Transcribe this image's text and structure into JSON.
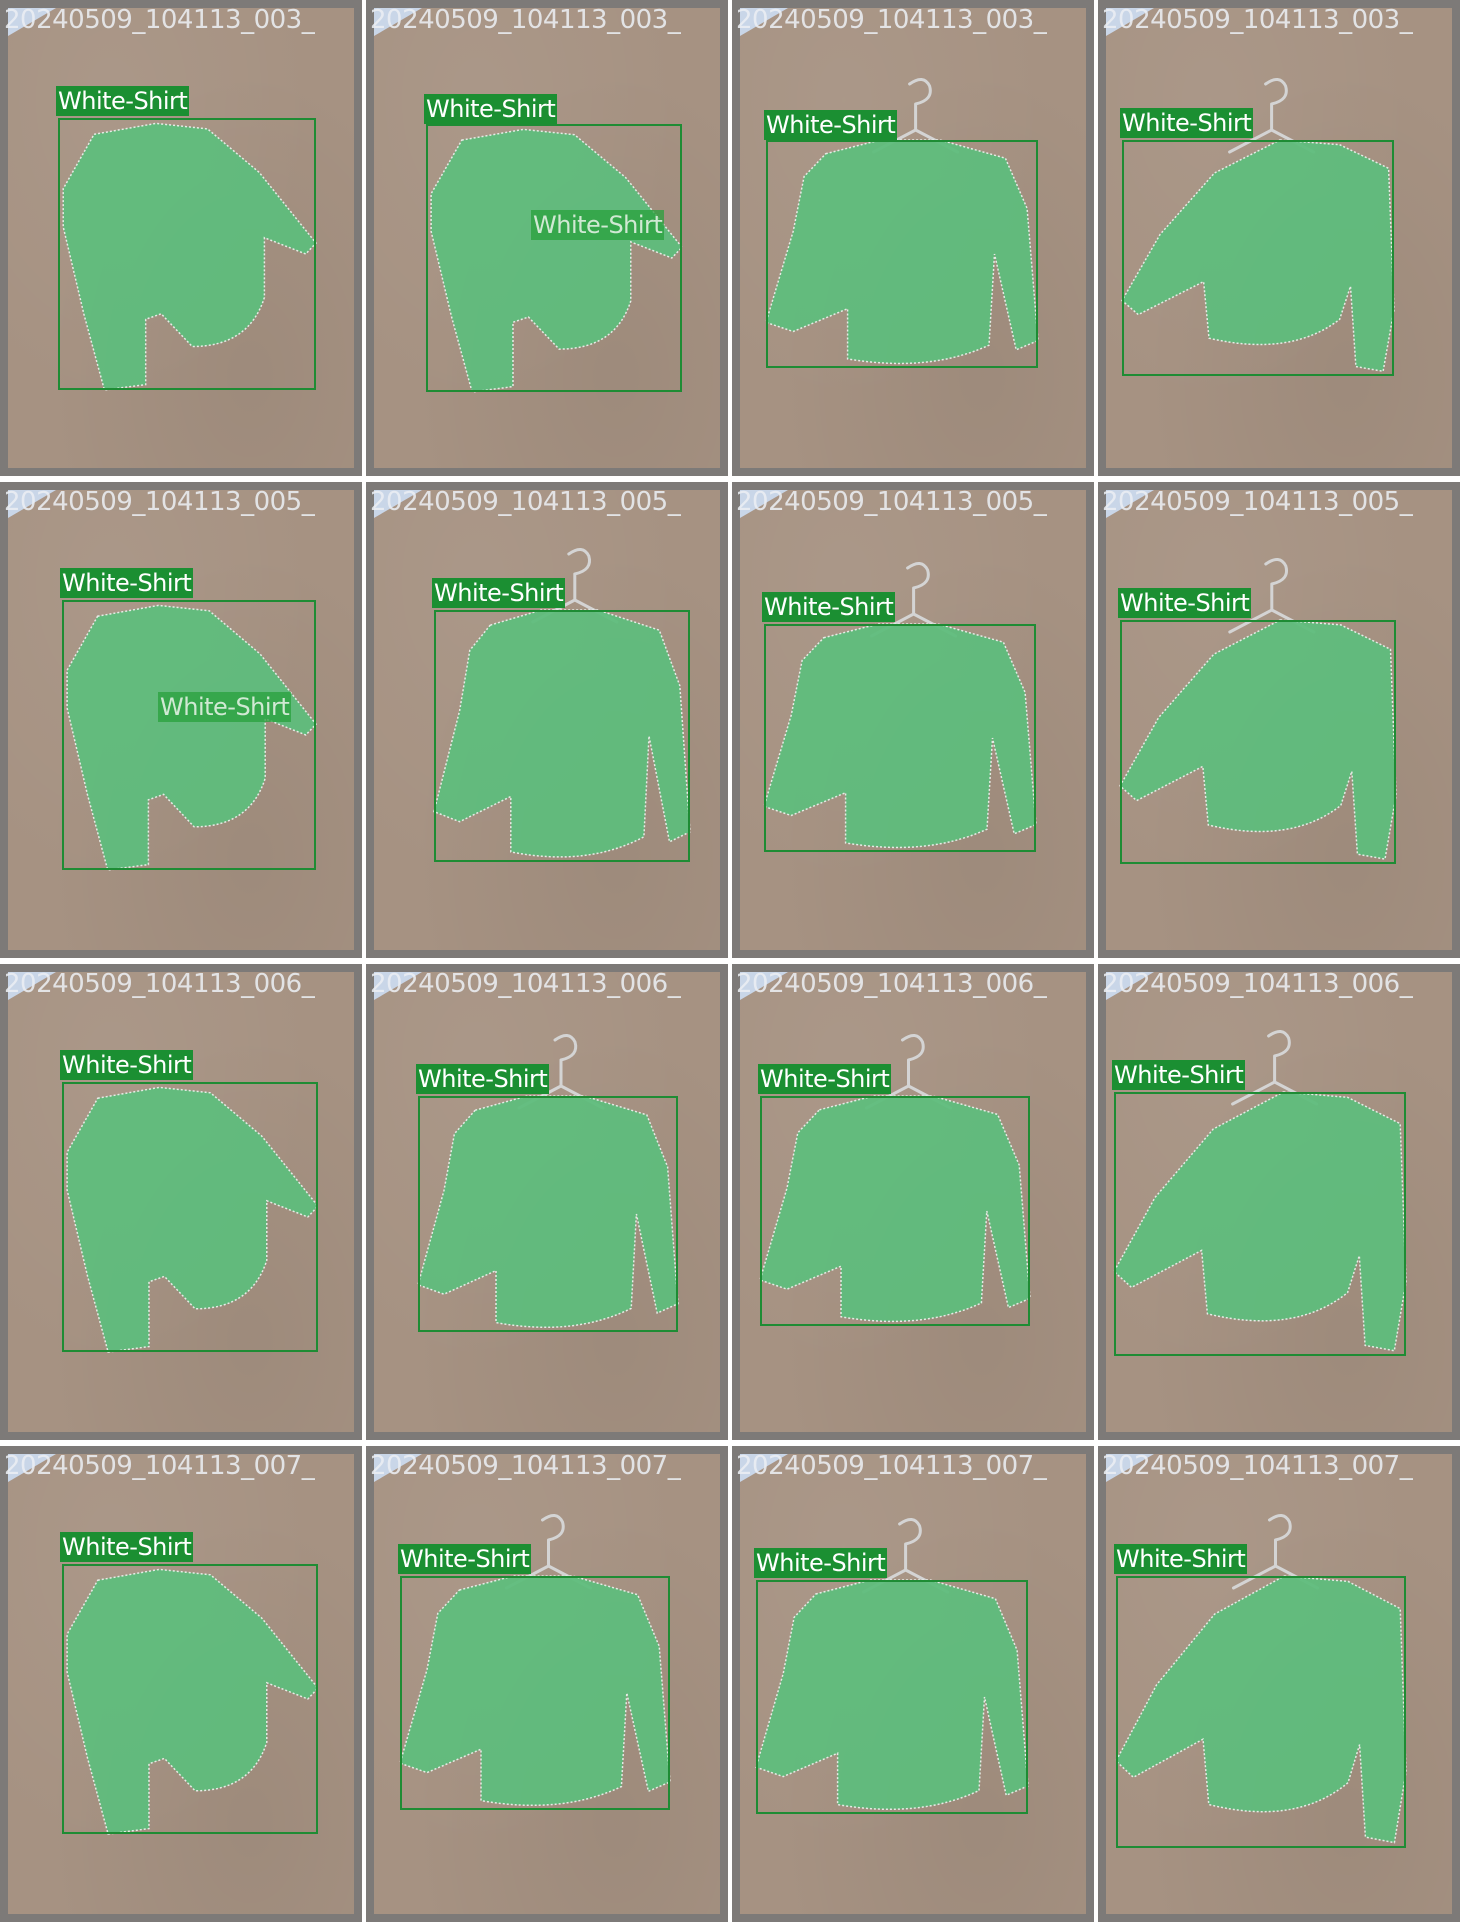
{
  "colors": {
    "mask": "#5fbd7c",
    "box": "#1e8c34",
    "label_bg": "#1b8f32",
    "frame": "#7d7a78",
    "board": "#a69282",
    "hanger": "#d4d4d4"
  },
  "tiles": [
    {
      "filename": "20240509_104113_003_",
      "pose": "tilted",
      "hanger": "hidden",
      "labels": [
        {
          "text": "White-Shirt"
        }
      ]
    },
    {
      "filename": "20240509_104113_003_",
      "pose": "tilted",
      "hanger": "hidden",
      "labels": [
        {
          "text": "White-Shirt"
        },
        {
          "text": "White-Shirt",
          "faded": true
        }
      ]
    },
    {
      "filename": "20240509_104113_003_",
      "pose": "straight",
      "hanger": "visible",
      "labels": [
        {
          "text": "White-Shirt"
        }
      ]
    },
    {
      "filename": "20240509_104113_003_",
      "pose": "mirrored",
      "hanger": "visible",
      "labels": [
        {
          "text": "White-Shirt"
        }
      ]
    },
    {
      "filename": "20240509_104113_005_",
      "pose": "tilted",
      "hanger": "hidden",
      "labels": [
        {
          "text": "White-Shirt"
        },
        {
          "text": "White-Shirt",
          "faded": true
        }
      ]
    },
    {
      "filename": "20240509_104113_005_",
      "pose": "straight",
      "hanger": "visible",
      "labels": [
        {
          "text": "White-Shirt"
        }
      ]
    },
    {
      "filename": "20240509_104113_005_",
      "pose": "straight",
      "hanger": "visible",
      "labels": [
        {
          "text": "White-Shirt"
        }
      ]
    },
    {
      "filename": "20240509_104113_005_",
      "pose": "mirrored",
      "hanger": "visible",
      "labels": [
        {
          "text": "White-Shirt"
        }
      ]
    },
    {
      "filename": "20240509_104113_006_",
      "pose": "tilted",
      "hanger": "hidden",
      "labels": [
        {
          "text": "White-Shirt"
        }
      ]
    },
    {
      "filename": "20240509_104113_006_",
      "pose": "straight",
      "hanger": "visible",
      "labels": [
        {
          "text": "White-Shirt"
        }
      ]
    },
    {
      "filename": "20240509_104113_006_",
      "pose": "straight",
      "hanger": "visible",
      "labels": [
        {
          "text": "White-Shirt"
        }
      ]
    },
    {
      "filename": "20240509_104113_006_",
      "pose": "mirrored",
      "hanger": "visible",
      "labels": [
        {
          "text": "White-Shirt"
        }
      ]
    },
    {
      "filename": "20240509_104113_007_",
      "pose": "tilted",
      "hanger": "hidden",
      "labels": [
        {
          "text": "White-Shirt"
        }
      ]
    },
    {
      "filename": "20240509_104113_007_",
      "pose": "straight",
      "hanger": "visible",
      "labels": [
        {
          "text": "White-Shirt"
        }
      ]
    },
    {
      "filename": "20240509_104113_007_",
      "pose": "straight",
      "hanger": "visible",
      "labels": [
        {
          "text": "White-Shirt"
        }
      ]
    },
    {
      "filename": "20240509_104113_007_",
      "pose": "mirrored",
      "hanger": "visible",
      "labels": [
        {
          "text": "White-Shirt"
        }
      ]
    }
  ]
}
